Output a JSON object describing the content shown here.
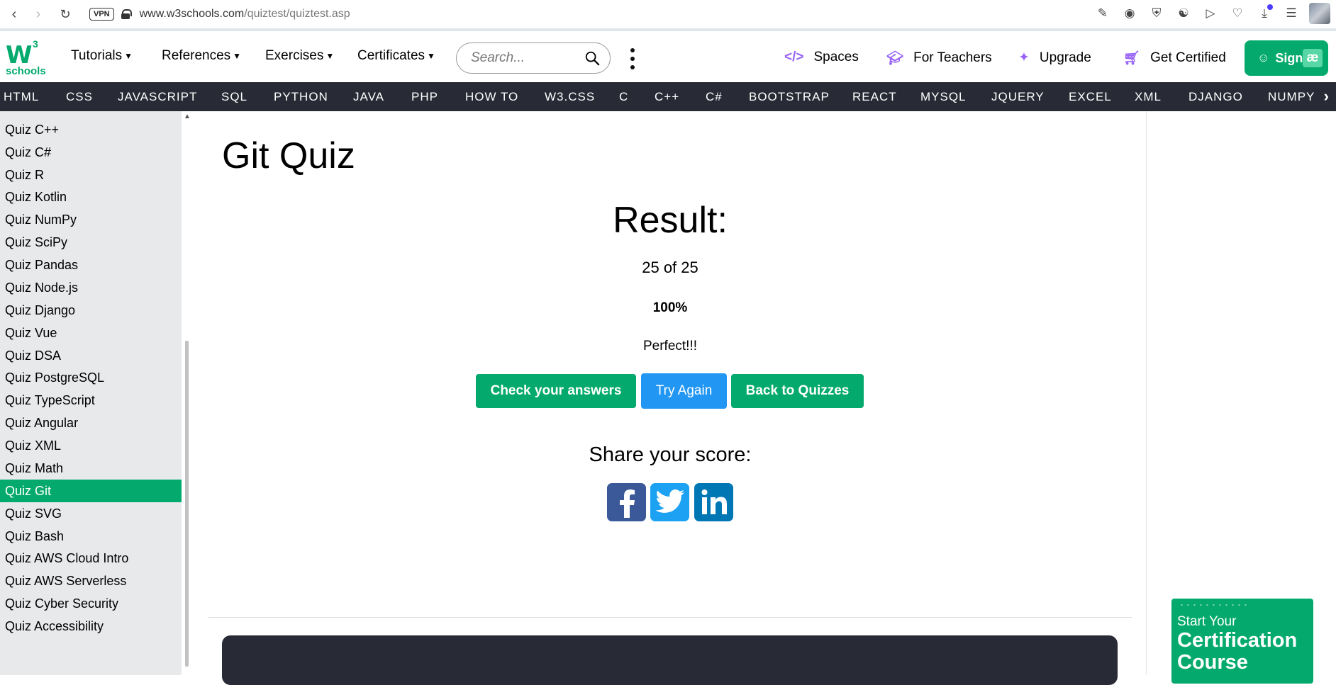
{
  "browser": {
    "url_domain": "www.w3schools.com",
    "url_path": "/quiztest/quiztest.asp",
    "vpn_label": "VPN"
  },
  "topnav": {
    "logo_sup": "3",
    "logo_text": "schools",
    "menu": [
      "Tutorials",
      "References",
      "Exercises",
      "Certificates"
    ],
    "search_placeholder": "Search...",
    "links": [
      "Spaces",
      "For Teachers",
      "Upgrade",
      "Get Certified"
    ],
    "sign_label": "Sign"
  },
  "langbar": [
    "HTML",
    "CSS",
    "JAVASCRIPT",
    "SQL",
    "PYTHON",
    "JAVA",
    "PHP",
    "HOW TO",
    "W3.CSS",
    "C",
    "C++",
    "C#",
    "BOOTSTRAP",
    "REACT",
    "MYSQL",
    "JQUERY",
    "EXCEL",
    "XML",
    "DJANGO",
    "NUMPY"
  ],
  "sidebar": {
    "items": [
      "Quiz C++",
      "Quiz C#",
      "Quiz R",
      "Quiz Kotlin",
      "Quiz NumPy",
      "Quiz SciPy",
      "Quiz Pandas",
      "Quiz Node.js",
      "Quiz Django",
      "Quiz Vue",
      "Quiz DSA",
      "Quiz PostgreSQL",
      "Quiz TypeScript",
      "Quiz Angular",
      "Quiz XML",
      "Quiz Math",
      "Quiz Git",
      "Quiz SVG",
      "Quiz Bash",
      "Quiz AWS Cloud Intro",
      "Quiz AWS Serverless",
      "Quiz Cyber Security",
      "Quiz Accessibility"
    ],
    "active": "Quiz Git"
  },
  "main": {
    "title": "Git Quiz",
    "result_heading": "Result:",
    "score": "25 of 25",
    "percent": "100%",
    "message": "Perfect!!!",
    "buttons": {
      "check": "Check your answers",
      "retry": "Try Again",
      "back": "Back to Quizzes"
    },
    "share_heading": "Share your score:"
  },
  "ad": {
    "line1": "Start Your",
    "line2": "Certification",
    "line3": "Course"
  },
  "colors": {
    "brand_green": "#04aa6d",
    "dark_bar": "#282a35",
    "blue": "#2196f3",
    "facebook": "#3b5998",
    "twitter": "#1da1f2",
    "linkedin": "#0077b5",
    "accent_purple": "#9763f6"
  }
}
